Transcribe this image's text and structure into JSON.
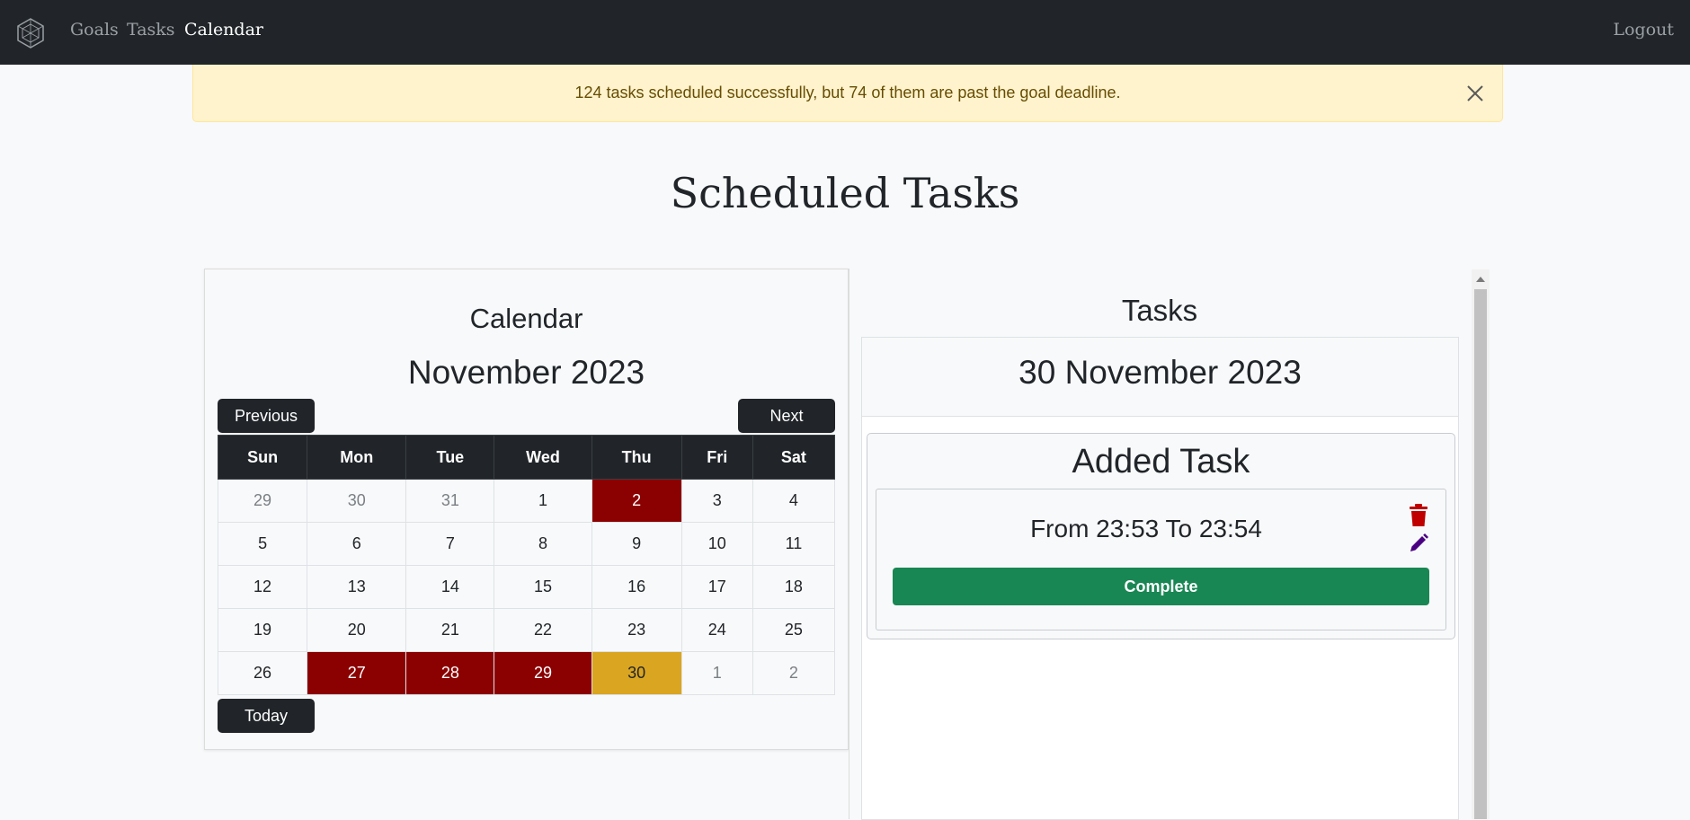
{
  "nav": {
    "brand_icon": "geodesic-logo-icon",
    "links": [
      "Goals",
      "Tasks",
      "Calendar"
    ],
    "active": "Calendar",
    "logout": "Logout"
  },
  "alert": {
    "message": "124 tasks scheduled successfully, but 74 of them are past the goal deadline.",
    "close_icon": "close-icon"
  },
  "page": {
    "title": "Scheduled Tasks"
  },
  "calendar": {
    "heading": "Calendar",
    "month_label": "November 2023",
    "prev_label": "Previous",
    "next_label": "Next",
    "today_label": "Today",
    "weekdays": [
      "Sun",
      "Mon",
      "Tue",
      "Wed",
      "Thu",
      "Fri",
      "Sat"
    ],
    "weeks": [
      [
        "29",
        "30",
        "31",
        "1",
        "2",
        "3",
        "4"
      ],
      [
        "5",
        "6",
        "7",
        "8",
        "9",
        "10",
        "11"
      ],
      [
        "12",
        "13",
        "14",
        "15",
        "16",
        "17",
        "18"
      ],
      [
        "19",
        "20",
        "21",
        "22",
        "23",
        "24",
        "25"
      ],
      [
        "26",
        "27",
        "28",
        "29",
        "30",
        "1",
        "2"
      ]
    ],
    "colors": {
      "overdue": "#8b0000",
      "selected": "#daa520"
    }
  },
  "tasks": {
    "heading": "Tasks",
    "date_label": "30 November 2023",
    "items": [
      {
        "title": "Added Task",
        "time_range": "From 23:53 To 23:54",
        "complete_label": "Complete",
        "delete_icon": "trash-icon",
        "edit_icon": "pencil-icon"
      }
    ]
  }
}
